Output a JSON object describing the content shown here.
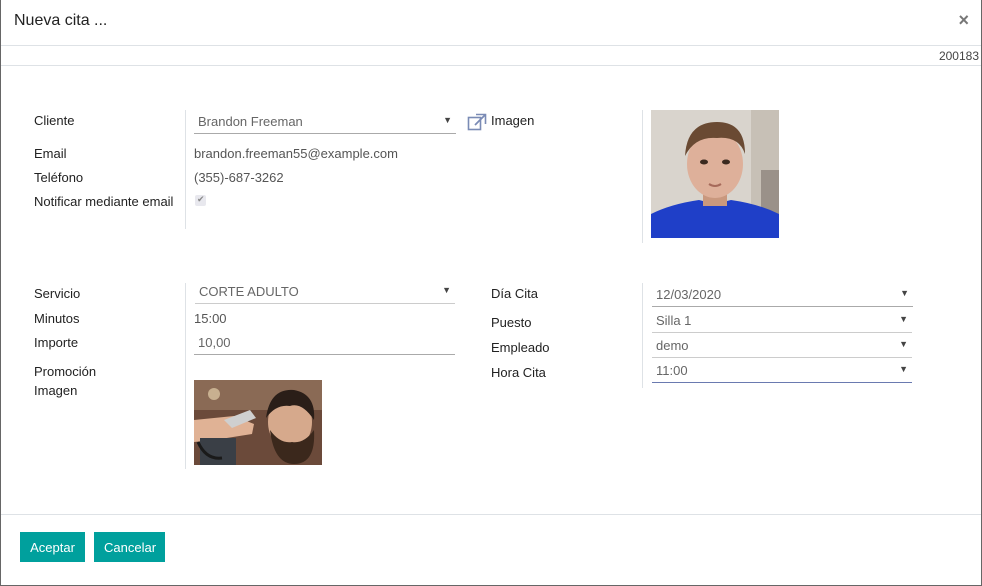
{
  "dialog": {
    "title": "Nueva cita ...",
    "close_label": "×",
    "record_id": "200183"
  },
  "client": {
    "cliente_label": "Cliente",
    "cliente_value": "Brandon Freeman",
    "email_label": "Email",
    "email_value": "brandon.freeman55@example.com",
    "telefono_label": "Teléfono",
    "telefono_value": "(355)-687-3262",
    "notificar_label": "Notificar mediante email",
    "imagen_label": "Imagen"
  },
  "service": {
    "servicio_label": "Servicio",
    "servicio_value": "CORTE ADULTO",
    "minutos_label": "Minutos",
    "minutos_value": "15:00",
    "importe_label": "Importe",
    "importe_value": "10,00",
    "promocion_label": "Promoción Imagen"
  },
  "appointment": {
    "dia_label": "Día Cita",
    "dia_value": "12/03/2020",
    "puesto_label": "Puesto",
    "puesto_value": "Silla 1",
    "empleado_label": "Empleado",
    "empleado_value": "demo",
    "hora_label": "Hora Cita",
    "hora_value": "11:00"
  },
  "footer": {
    "accept_label": "Aceptar",
    "cancel_label": "Cancelar"
  },
  "colors": {
    "accent": "#00a09d"
  }
}
